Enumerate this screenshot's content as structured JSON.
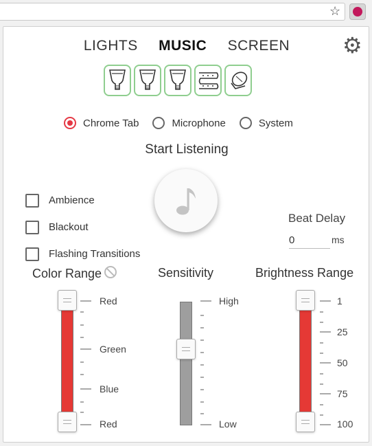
{
  "browser": {
    "star_icon": "star-icon",
    "extension_icon": "hue-extension-icon"
  },
  "tabs": [
    {
      "label": "LIGHTS",
      "active": false
    },
    {
      "label": "MUSIC",
      "active": true
    },
    {
      "label": "SCREEN",
      "active": false
    }
  ],
  "settings_icon": "gear-icon",
  "lights": [
    {
      "icon": "bulb-icon",
      "selected": true
    },
    {
      "icon": "bulb-icon",
      "selected": true
    },
    {
      "icon": "bulb-icon",
      "selected": true
    },
    {
      "icon": "lightstrip-icon",
      "selected": true
    },
    {
      "icon": "lamp-icon",
      "selected": true
    }
  ],
  "sources": [
    {
      "label": "Chrome Tab",
      "selected": true
    },
    {
      "label": "Microphone",
      "selected": false
    },
    {
      "label": "System",
      "selected": false
    }
  ],
  "start_label": "Start Listening",
  "music_icon": "music-note-icon",
  "options": [
    {
      "label": "Ambience",
      "checked": false
    },
    {
      "label": "Blackout",
      "checked": false
    },
    {
      "label": "Flashing Transitions",
      "checked": false
    }
  ],
  "beat_delay": {
    "label": "Beat Delay",
    "value": "0",
    "unit": "ms"
  },
  "color_range": {
    "title": "Color Range",
    "disabled_icon": "disabled-icon",
    "labels": [
      "Red",
      "Green",
      "Blue",
      "Red"
    ],
    "range_fraction": [
      0.0,
      1.0
    ],
    "fill_color": "#e53935"
  },
  "sensitivity": {
    "title": "Sensitivity",
    "labels": [
      "High",
      "Low"
    ],
    "value_fraction": 0.41,
    "fill_color": "#9e9e9e"
  },
  "brightness_range": {
    "title": "Brightness Range",
    "labels": [
      "1",
      "25",
      "50",
      "75",
      "100"
    ],
    "range": [
      1,
      100
    ],
    "fill_color": "#e53935"
  }
}
